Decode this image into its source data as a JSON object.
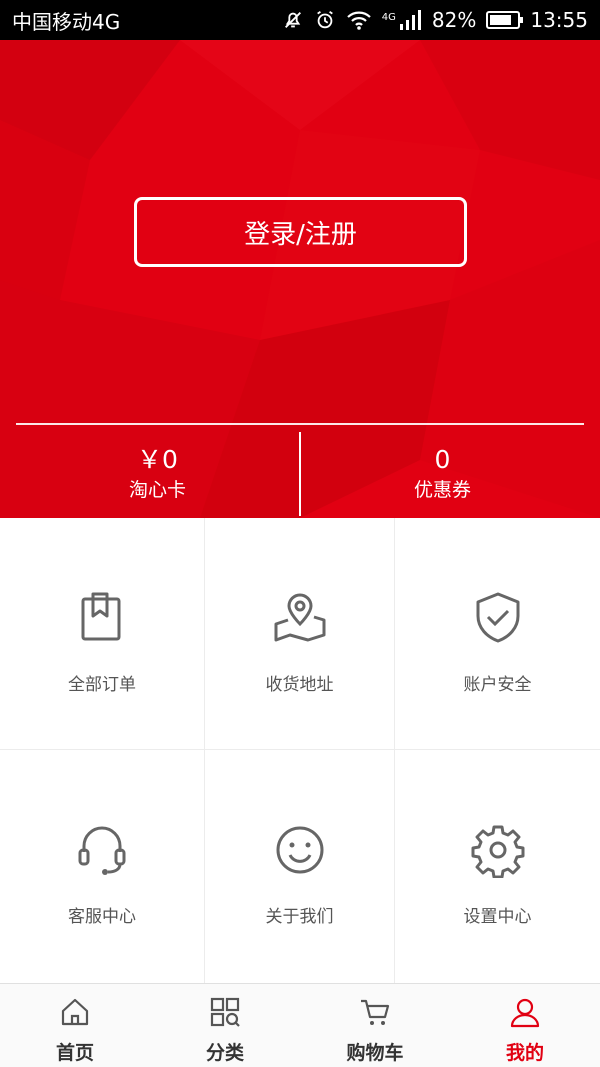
{
  "status_bar": {
    "carrier": "中国移动4G",
    "network": "4G",
    "battery": "82%",
    "battery_level": 0.82,
    "time": "13:55"
  },
  "header": {
    "login_label": "登录/注册",
    "stats": [
      {
        "value": "￥0",
        "label": "淘心卡"
      },
      {
        "value": "0",
        "label": "优惠券"
      }
    ]
  },
  "grid": {
    "items": [
      {
        "label": "全部订单",
        "icon": "clipboard-icon"
      },
      {
        "label": "收货地址",
        "icon": "map-pin-icon"
      },
      {
        "label": "账户安全",
        "icon": "shield-check-icon"
      },
      {
        "label": "客服中心",
        "icon": "headset-icon"
      },
      {
        "label": "关于我们",
        "icon": "smiley-icon"
      },
      {
        "label": "设置中心",
        "icon": "gear-icon"
      }
    ]
  },
  "bottom_nav": {
    "items": [
      {
        "label": "首页",
        "icon": "home-icon"
      },
      {
        "label": "分类",
        "icon": "category-icon"
      },
      {
        "label": "购物车",
        "icon": "cart-icon"
      },
      {
        "label": "我的",
        "icon": "user-icon",
        "active": true
      }
    ]
  },
  "colors": {
    "brand_red": "#e10012",
    "icon_gray": "#666666",
    "text_gray": "#555555"
  }
}
